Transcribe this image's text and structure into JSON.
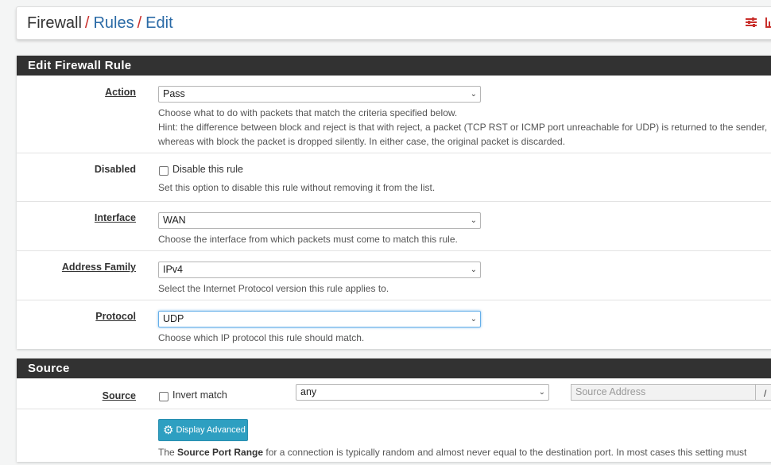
{
  "breadcrumb": {
    "items": [
      "Firewall",
      "Rules",
      "Edit"
    ],
    "separator": "/"
  },
  "header_icons": [
    "sliders-icon",
    "chart-icon"
  ],
  "edit_panel": {
    "title": "Edit Firewall Rule",
    "action": {
      "label": "Action",
      "value": "Pass",
      "help": [
        "Choose what to do with packets that match the criteria specified below.",
        "Hint: the difference between block and reject is that with reject, a packet (TCP RST or ICMP port unreachable for UDP) is returned to the sender,",
        "whereas with block the packet is dropped silently. In either case, the original packet is discarded."
      ]
    },
    "disabled": {
      "label": "Disabled",
      "checkbox_label": "Disable this rule",
      "checked": false,
      "help": "Set this option to disable this rule without removing it from the list."
    },
    "interface": {
      "label": "Interface",
      "value": "WAN",
      "help": "Choose the interface from which packets must come to match this rule."
    },
    "address_family": {
      "label": "Address Family",
      "value": "IPv4",
      "help": "Select the Internet Protocol version this rule applies to."
    },
    "protocol": {
      "label": "Protocol",
      "value": "UDP",
      "help": "Choose which IP protocol this rule should match."
    }
  },
  "source_panel": {
    "title": "Source",
    "source": {
      "label": "Source",
      "invert_label": "Invert match",
      "invert_checked": false,
      "type_value": "any",
      "address_placeholder": "Source Address",
      "slash": "/"
    },
    "advanced_button": "Display Advanced",
    "help_prefix": "The ",
    "help_bold": "Source Port Range",
    "help_suffix": " for a connection is typically random and almost never equal to the destination port. In most cases this setting must"
  },
  "colors": {
    "heading_bg": "#323232",
    "link": "#2a6aa6",
    "separator": "#c9302c",
    "button": "#2e9fc1"
  }
}
